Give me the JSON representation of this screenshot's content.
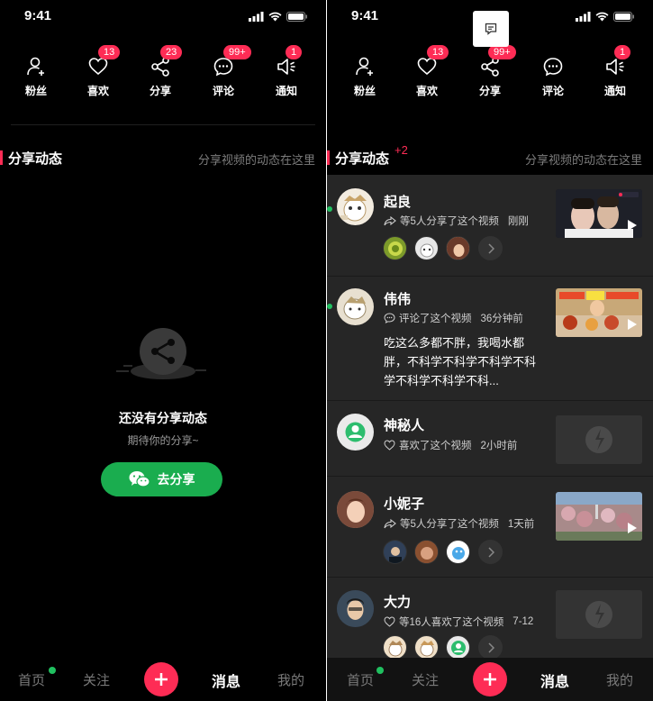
{
  "status": {
    "time": "9:41"
  },
  "topnav": [
    {
      "label": "粉丝",
      "icon": "person-add-icon",
      "badge": ""
    },
    {
      "label": "喜欢",
      "icon": "heart-icon",
      "badge": "13"
    },
    {
      "label": "分享",
      "icon": "share-icon",
      "badge": "23"
    },
    {
      "label": "评论",
      "icon": "comment-icon",
      "badge": "99+"
    },
    {
      "label": "通知",
      "icon": "speaker-icon",
      "badge": "1"
    }
  ],
  "left": {
    "section_title": "分享动态",
    "section_hint": "分享视频的动态在这里",
    "empty_title": "还没有分享动态",
    "empty_sub": "期待你的分享~",
    "share_button": "去分享"
  },
  "right": {
    "section_title": "分享动态",
    "section_plus": "+2",
    "section_hint": "分享视频的动态在这里",
    "feed": [
      {
        "name": "起良",
        "action": "等5人分享了这个视频",
        "time": "刚刚",
        "icon": "share-arrow-icon"
      },
      {
        "name": "伟伟",
        "action": "评论了这个视频",
        "time": "36分钟前",
        "icon": "comment-icon",
        "comment": "吃这么多都不胖，我喝水都胖，不科学不科学不科学不科学不科学不科学不科..."
      },
      {
        "name": "神秘人",
        "action": "喜欢了这个视频",
        "time": "2小时前",
        "icon": "heart-icon"
      },
      {
        "name": "小妮子",
        "action": "等5人分享了这个视频",
        "time": "1天前",
        "icon": "share-arrow-icon"
      },
      {
        "name": "大力",
        "action": "等16人喜欢了这个视频",
        "time": "7-12",
        "icon": "heart-icon"
      }
    ]
  },
  "bottom_tabs": [
    "首页",
    "关注",
    "消息",
    "我的"
  ],
  "colors": {
    "accent": "#fe2c55",
    "green": "#1aad4f",
    "feed_bg": "#262626"
  }
}
